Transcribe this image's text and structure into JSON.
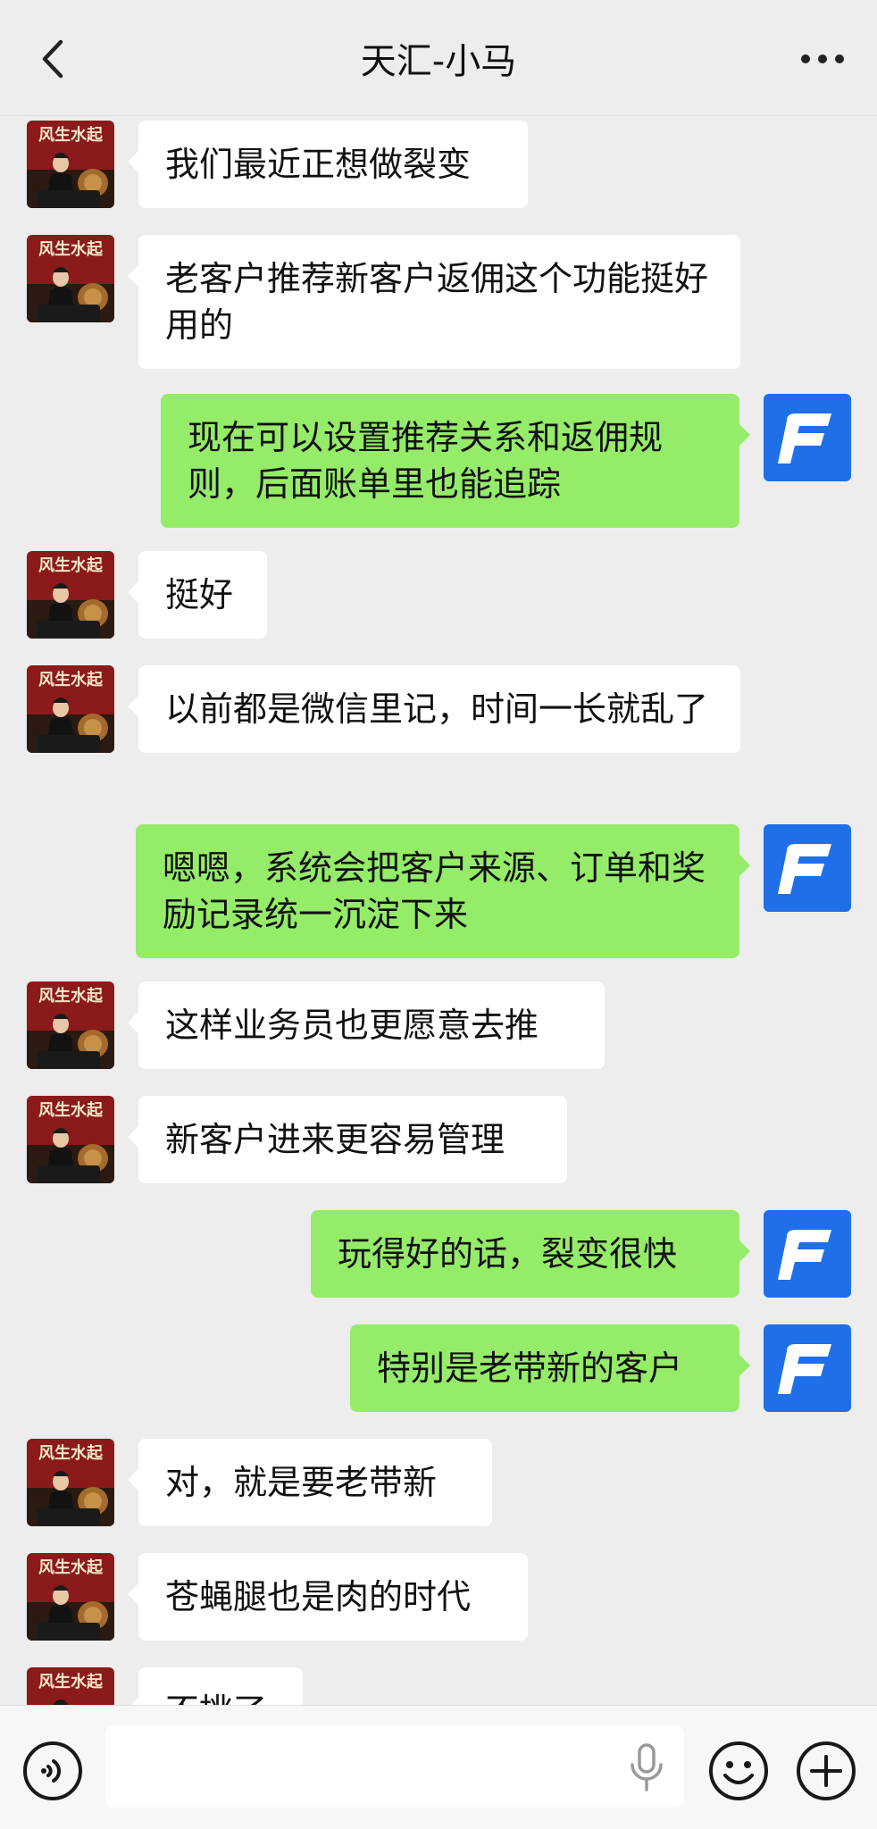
{
  "header": {
    "title": "天汇-小马",
    "back_icon": "chevron-left-icon",
    "more_icon": "more-horizontal-icon"
  },
  "contact": {
    "avatar_text": "风生水起",
    "avatar_icon": "contact-avatar-image"
  },
  "me": {
    "avatar_icon": "f-logo-avatar",
    "brand_color": "#1f6fe8"
  },
  "messages": [
    {
      "side": "in",
      "text": "我们最近正想做裂变"
    },
    {
      "side": "in",
      "text": "老客户推荐新客户返佣这个功能挺好用的"
    },
    {
      "side": "out",
      "text": "现在可以设置推荐关系和返佣规则，后面账单里也能追踪"
    },
    {
      "side": "in",
      "text": "挺好"
    },
    {
      "side": "in",
      "text": "以前都是微信里记，时间一长就乱了"
    },
    {
      "side": "out",
      "text": "嗯嗯，系统会把客户来源、订单和奖励记录统一沉淀下来"
    },
    {
      "side": "in",
      "text": "这样业务员也更愿意去推"
    },
    {
      "side": "in",
      "text": "新客户进来更容易管理"
    },
    {
      "side": "out",
      "text": "玩得好的话，裂变很快"
    },
    {
      "side": "out",
      "text": "特别是老带新的客户"
    },
    {
      "side": "in",
      "text": "对，就是要老带新"
    },
    {
      "side": "in",
      "text": "苍蝇腿也是肉的时代"
    },
    {
      "side": "in",
      "text": "不挑了"
    }
  ],
  "composer": {
    "placeholder": "",
    "voice_icon": "voice-toggle-icon",
    "mic_icon": "microphone-icon",
    "emoji_icon": "emoji-icon",
    "plus_icon": "add-icon"
  },
  "colors": {
    "background": "#ededed",
    "incoming_bubble": "#ffffff",
    "outgoing_bubble": "#95ec69"
  }
}
